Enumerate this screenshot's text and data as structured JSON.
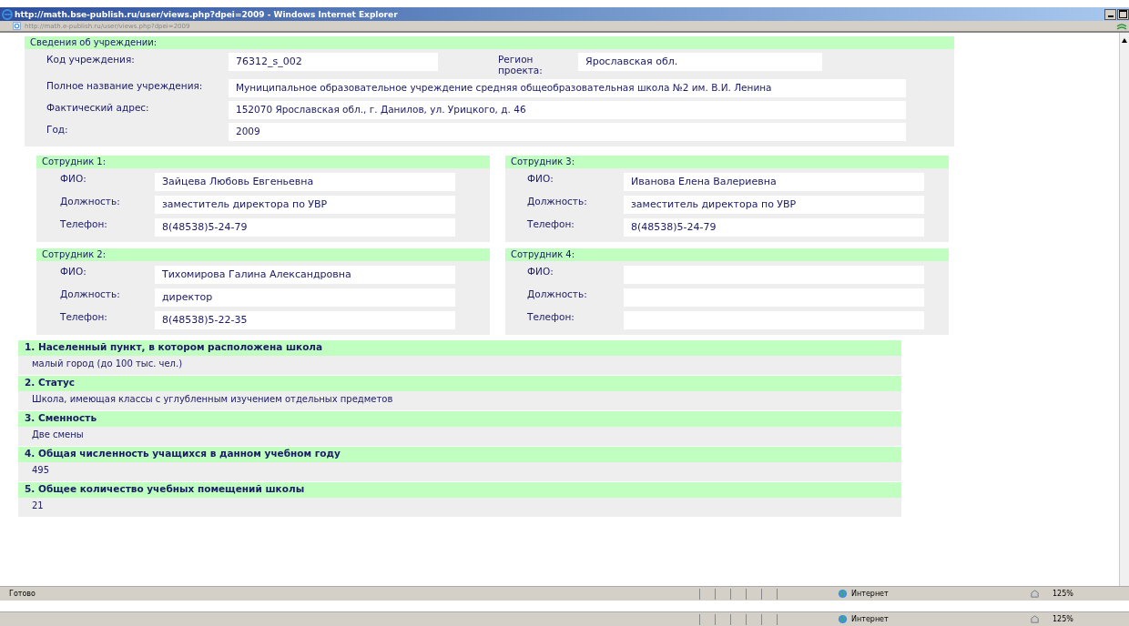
{
  "window": {
    "title": "http://math.bse-publish.ru/user/views.php?dpei=2009 - Windows Internet Explorer",
    "address": "http://math.e-publish.ru/user/views.php?dpei=2009"
  },
  "institution": {
    "header": "Сведения об учреждении:",
    "code": {
      "label": "Код учреждения:",
      "value": "76312_s_002"
    },
    "region": {
      "label": "Регион проекта:",
      "value": "Ярославская обл."
    },
    "full_name": {
      "label": "Полное название учреждения:",
      "value": "Муниципальное образовательное учреждение средняя общеобразовательная школа №2 им. В.И. Ленина"
    },
    "address": {
      "label": "Фактический адрес:",
      "value": "152070 Ярославская обл., г. Данилов, ул. Урицкого, д. 46"
    },
    "year": {
      "label": "Год:",
      "value": "2009"
    }
  },
  "employees": [
    {
      "title": "Сотрудник 1:",
      "fields": [
        {
          "label": "ФИО:",
          "value": "Зайцева Любовь Евгеньевна"
        },
        {
          "label": "Должность:",
          "value": "заместитель директора по УВР"
        },
        {
          "label": "Телефон:",
          "value": "8(48538)5-24-79"
        }
      ]
    },
    {
      "title": "Сотрудник 3:",
      "fields": [
        {
          "label": "ФИО:",
          "value": "Иванова Елена Валериевна"
        },
        {
          "label": "Должность:",
          "value": "заместитель директора по УВР"
        },
        {
          "label": "Телефон:",
          "value": "8(48538)5-24-79"
        }
      ]
    },
    {
      "title": "Сотрудник 2:",
      "fields": [
        {
          "label": "ФИО:",
          "value": "Тихомирова Галина Александровна"
        },
        {
          "label": "Должность:",
          "value": "директор"
        },
        {
          "label": "Телефон:",
          "value": "8(48538)5-22-35"
        }
      ]
    },
    {
      "title": "Сотрудник 4:",
      "fields": [
        {
          "label": "ФИО:"
        },
        {
          "label": "Должность:"
        },
        {
          "label": "Телефон:"
        }
      ]
    }
  ],
  "questions": [
    {
      "title": "1. Населенный пункт, в котором расположена школа",
      "answer": "малый город (до 100 тыс. чел.)"
    },
    {
      "title": "2. Статус",
      "answer": "Школа, имеющая классы с углубленным изучением отдельных предметов"
    },
    {
      "title": "3. Сменность",
      "answer": "Две смены"
    },
    {
      "title": "4. Общая численность учащихся в данном учебном году",
      "answer": "495"
    },
    {
      "title": "5. Общее количество учебных помещений школы",
      "answer": "21"
    }
  ],
  "status_bars": [
    {
      "text": "Готово",
      "zone": "Интернет",
      "zoom": "125%"
    },
    {
      "zone": "Интернет",
      "zoom": "125%"
    }
  ]
}
